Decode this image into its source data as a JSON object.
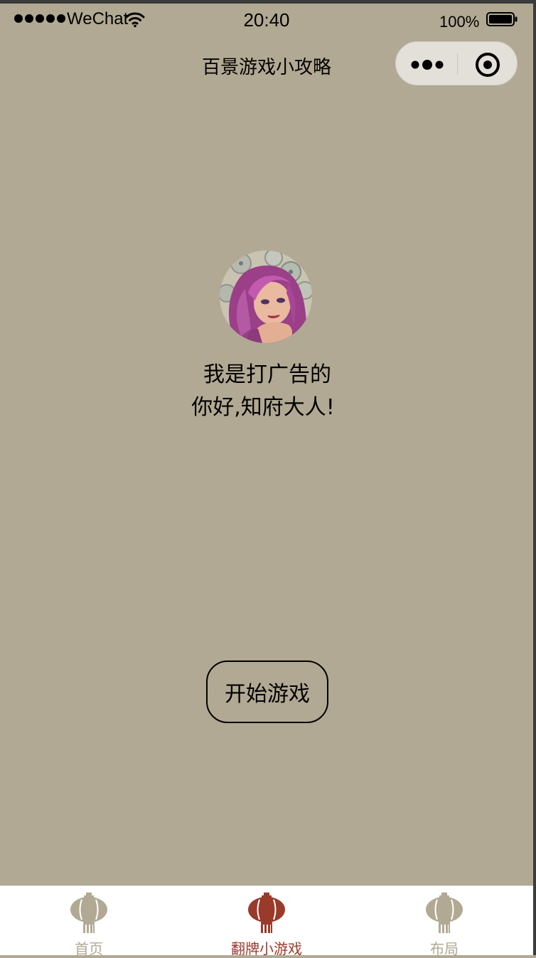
{
  "status_bar": {
    "carrier": "WeChat",
    "time": "20:40",
    "battery": "100%"
  },
  "nav": {
    "title": "百景游戏小攻略"
  },
  "content": {
    "intro_line1": "我是打广告的",
    "intro_line2": "你好,知府大人!",
    "start_button": "开始游戏"
  },
  "tab_bar": {
    "active_color": "#9a3a2a",
    "inactive_color": "#b1a993",
    "tabs": [
      {
        "label": "首页",
        "icon": "lantern-icon",
        "active": false
      },
      {
        "label": "翻牌小游戏",
        "icon": "lantern-icon",
        "active": true
      },
      {
        "label": "布局",
        "icon": "lantern-icon",
        "active": false
      }
    ]
  },
  "colors": {
    "background": "#b1a993",
    "capsule": "#e3e0d9"
  }
}
